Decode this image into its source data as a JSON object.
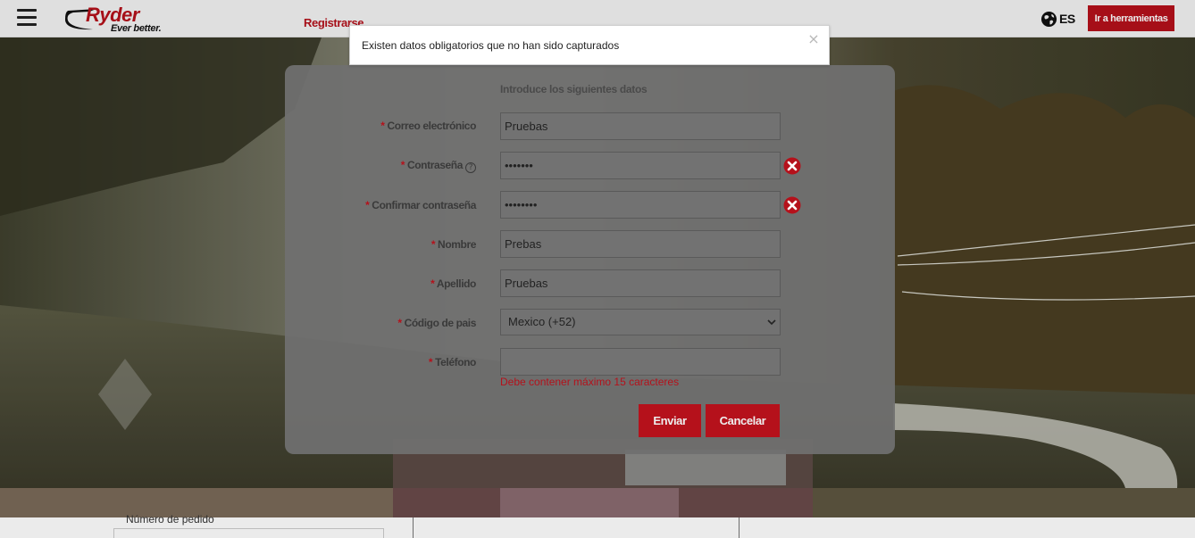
{
  "header": {
    "brand": "Ryder",
    "tagline": "Ever better.",
    "register_link": "Registrarse",
    "language": "ES",
    "tools_button": "Ir a herramientas"
  },
  "alert": {
    "message": "Existen datos obligatorios que no han sido capturados",
    "close": "×"
  },
  "form": {
    "heading": "Introduce los siguientes datos",
    "required_marker": "*",
    "fields": [
      {
        "label": "Correo electrónico",
        "value": "Pruebas",
        "type": "text"
      },
      {
        "label": "Contraseña",
        "value": "•••••••",
        "type": "password",
        "help": "?",
        "error": true
      },
      {
        "label": "Confirmar contraseña",
        "value": "••••••••",
        "type": "password",
        "error": true
      },
      {
        "label": "Nombre",
        "value": "Prebas",
        "type": "text"
      },
      {
        "label": "Apellido",
        "value": "Pruebas",
        "type": "text"
      },
      {
        "label": "Código de pais",
        "value": "Mexico (+52)",
        "type": "select"
      },
      {
        "label": "Teléfono",
        "value": "",
        "type": "text"
      }
    ],
    "phone_error": "Debe contener máximo 15 caracteres",
    "submit_button": "Enviar",
    "cancel_button": "Cancelar"
  },
  "bottom": {
    "order_label": "Número de pedido"
  },
  "colors": {
    "accent": "#b5111b",
    "modal_bg": "#707070",
    "header_bg": "#f2f2f2"
  },
  "icons": {
    "menu": "hamburger-icon",
    "globe": "globe-icon",
    "close": "close-icon",
    "help": "help-circle-icon",
    "error": "error-x-circle-icon",
    "chevron": "chevron-down-icon"
  }
}
